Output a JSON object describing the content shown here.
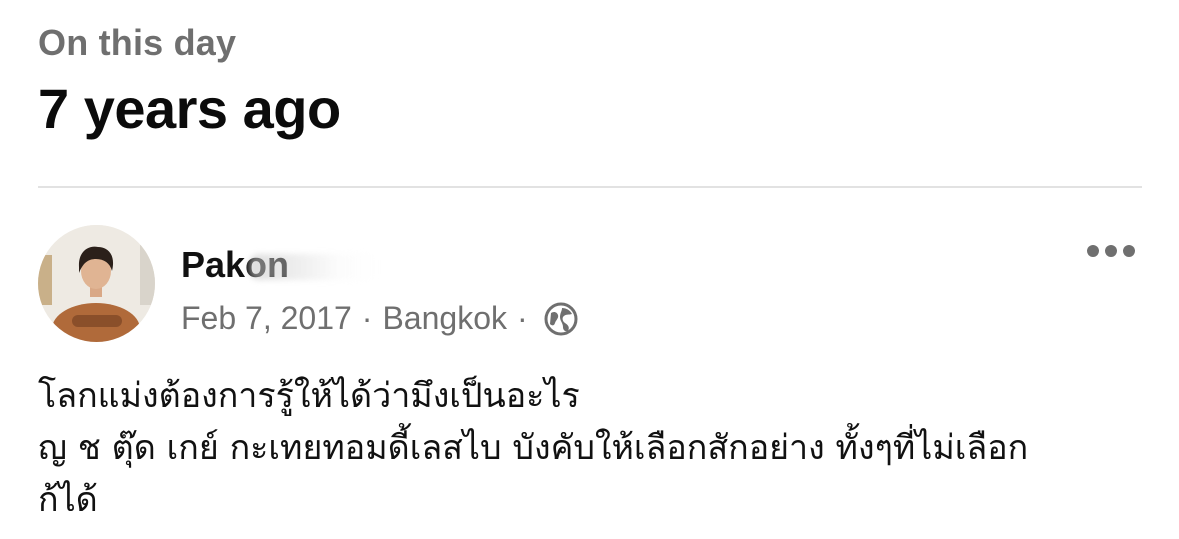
{
  "memory": {
    "kicker": "On this day",
    "headline": "7 years ago"
  },
  "post": {
    "author": {
      "name": "Pakon",
      "avatar_icon": "profile-photo"
    },
    "meta": {
      "date": "Feb 7, 2017",
      "separator": "·",
      "location": "Bangkok",
      "privacy_icon": "globe-icon"
    },
    "more_icon": "more-options-icon",
    "text_lines": [
      "โลกแม่งต้องการรู้ให้ได้ว่ามึงเป็นอะไร",
      "ญ ช ตุ๊ด เกย์ กะเทยทอมดี้เลสไบ บังคับให้เลือกสักอย่าง ทั้งๆที่ไม่เลือก",
      "ก้ได้"
    ]
  },
  "colors": {
    "text_primary": "#111111",
    "text_secondary": "#6f6f6f",
    "divider": "#e2e2e2"
  }
}
